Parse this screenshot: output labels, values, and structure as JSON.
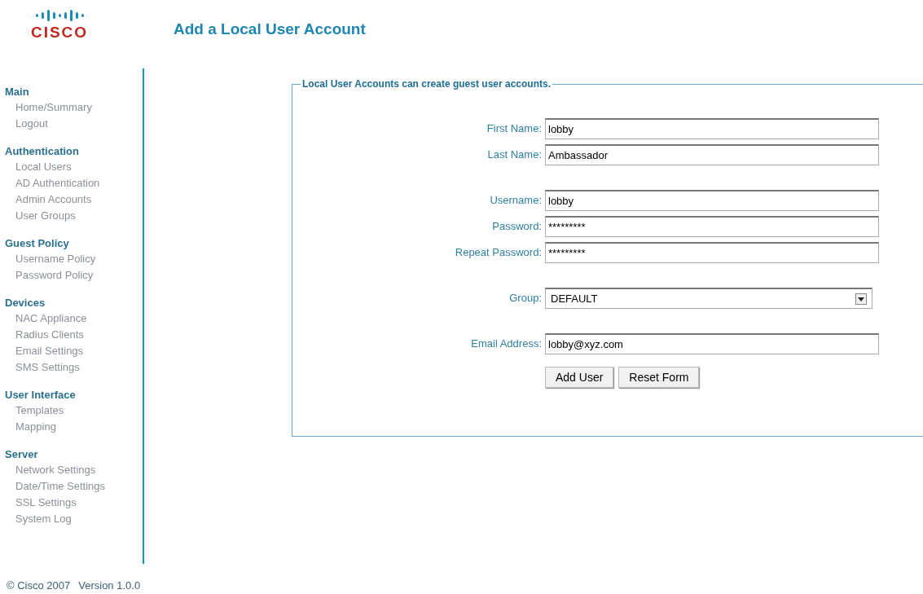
{
  "logo": {
    "wordmark": "CISCO"
  },
  "page_title": "Add a Local User Account",
  "sidebar": {
    "sections": [
      {
        "title": "Main",
        "items": [
          "Home/Summary",
          "Logout"
        ]
      },
      {
        "title": "Authentication",
        "items": [
          "Local Users",
          "AD Authentication",
          "Admin Accounts",
          "User Groups"
        ]
      },
      {
        "title": "Guest Policy",
        "items": [
          "Username Policy",
          "Password Policy"
        ]
      },
      {
        "title": "Devices",
        "items": [
          "NAC Appliance",
          "Radius Clients",
          "Email Settings",
          "SMS Settings"
        ]
      },
      {
        "title": "User Interface",
        "items": [
          "Templates",
          "Mapping"
        ]
      },
      {
        "title": "Server",
        "items": [
          "Network Settings",
          "Date/Time Settings",
          "SSL Settings",
          "System Log"
        ]
      }
    ]
  },
  "form": {
    "legend": "Local User Accounts can create guest user accounts.",
    "groups": [
      [
        {
          "kind": "text",
          "label": "First Name:",
          "value": "lobby"
        },
        {
          "kind": "text",
          "label": "Last Name:",
          "value": "Ambassador"
        }
      ],
      [
        {
          "kind": "text",
          "label": "Username:",
          "value": "lobby"
        },
        {
          "kind": "text",
          "label": "Password:",
          "value": "*********"
        },
        {
          "kind": "text",
          "label": "Repeat Password:",
          "value": "*********"
        }
      ],
      [
        {
          "kind": "select",
          "label": "Group:",
          "value": "DEFAULT"
        }
      ],
      [
        {
          "kind": "text",
          "label": "Email Address:",
          "value": "lobby@xyz.com"
        }
      ]
    ],
    "buttons": [
      "Add User",
      "Reset Form"
    ]
  },
  "footer": {
    "copyright": "© Cisco 2007",
    "version": "Version 1.0.0"
  }
}
